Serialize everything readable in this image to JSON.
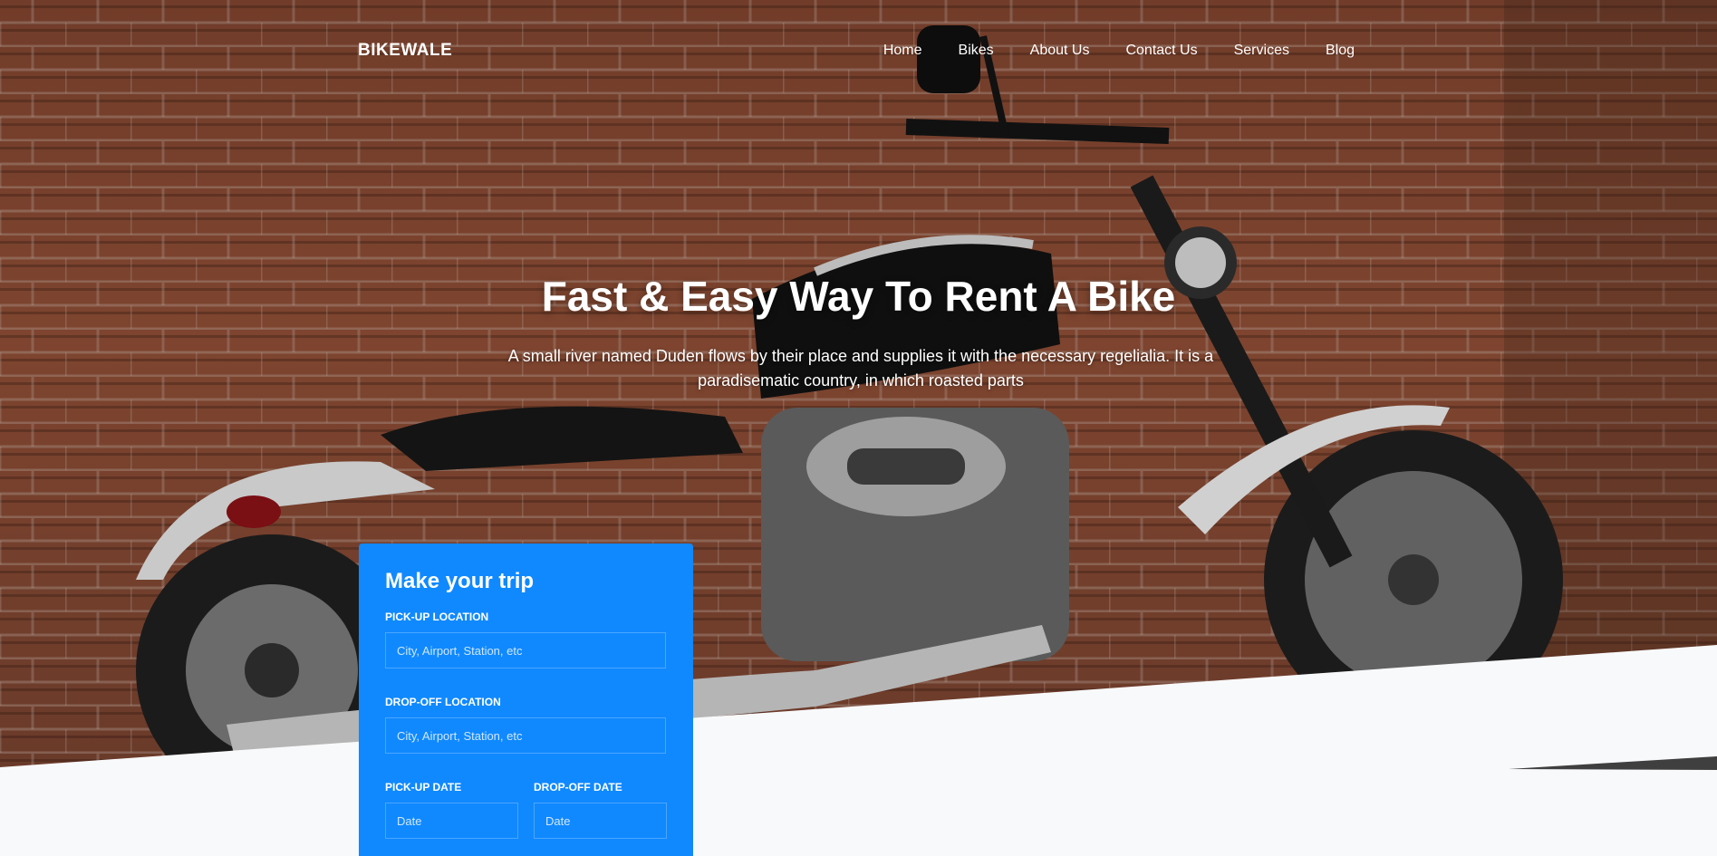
{
  "nav": {
    "brand": "BIKEWALE",
    "items": [
      {
        "label": "Home"
      },
      {
        "label": "Bikes"
      },
      {
        "label": "About Us"
      },
      {
        "label": "Contact Us"
      },
      {
        "label": "Services"
      },
      {
        "label": "Blog"
      }
    ]
  },
  "hero": {
    "headline": "Fast & Easy Way To Rent A Bike",
    "subtext": "A small river named Duden flows by their place and supplies it with the necessary regelialia. It is a paradisematic country, in which roasted parts"
  },
  "trip_form": {
    "title": "Make your trip",
    "pickup_location": {
      "label": "PICK-UP LOCATION",
      "placeholder": "City, Airport, Station, etc"
    },
    "dropoff_location": {
      "label": "DROP-OFF LOCATION",
      "placeholder": "City, Airport, Station, etc"
    },
    "pickup_date": {
      "label": "PICK-UP DATE",
      "placeholder": "Date"
    },
    "dropoff_date": {
      "label": "DROP-OFF DATE",
      "placeholder": "Date"
    }
  },
  "colors": {
    "accent": "#1089ff",
    "background": "#f8f9fb",
    "brick": "#8a4a33"
  }
}
